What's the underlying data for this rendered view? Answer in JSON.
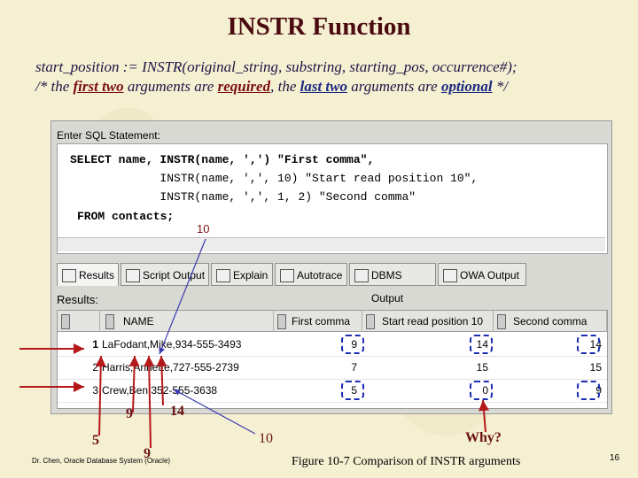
{
  "slide": {
    "title": "INSTR Function",
    "syntax": "start_position := INSTR(original_string, substring, starting_pos, occurrence#);",
    "comment_prefix": "/* the ",
    "comment_first_two": "first two",
    "comment_mid": " arguments are ",
    "comment_required": "required",
    "comment_mid2": ", the ",
    "comment_last_two": "last two",
    "comment_mid3": " arguments are ",
    "comment_optional": "optional",
    "comment_end": " */"
  },
  "editor": {
    "label": "Enter SQL Statement:",
    "lines": [
      "SELECT name, INSTR(name, ',') \"First comma\",",
      "             INSTR(name, ',', 10) \"Start read position 10\",",
      "             INSTR(name, ',', 1, 2) \"Second comma\"",
      "FROM contacts;"
    ]
  },
  "tabs": [
    {
      "label": "Results",
      "icon": "results-icon"
    },
    {
      "label": "Script Output",
      "icon": "script-icon"
    },
    {
      "label": "Explain",
      "icon": "explain-icon"
    },
    {
      "label": "Autotrace",
      "icon": "autotrace-icon"
    },
    {
      "label": "DBMS Output",
      "icon": "dbms-icon"
    },
    {
      "label": "OWA Output",
      "icon": "owa-icon"
    }
  ],
  "results": {
    "label": "Results:",
    "columns": [
      "NAME",
      "First comma",
      "Start read position 10",
      "Second comma"
    ],
    "rows": [
      {
        "num": "1",
        "name": "LaFodant,Mike,934-555-3493",
        "first": "9",
        "start10": "14",
        "second": "14"
      },
      {
        "num": "2",
        "name": "Harris,Annette,727-555-2739",
        "first": "7",
        "start10": "15",
        "second": "15"
      },
      {
        "num": "3",
        "name": "Crew,Ben,352-555-3638",
        "first": "5",
        "start10": "0",
        "second": "9"
      }
    ]
  },
  "annotations": {
    "ten_top": "10",
    "ten_bottom": "10",
    "nine_a": "9",
    "nine_b": "9",
    "fourteen": "14",
    "five": "5",
    "why": "Why?"
  },
  "footer": {
    "author": "Dr. Chen, Oracle Database System (Oracle)",
    "caption": "Figure 10-7 Comparison of INSTR arguments",
    "page": "16"
  }
}
